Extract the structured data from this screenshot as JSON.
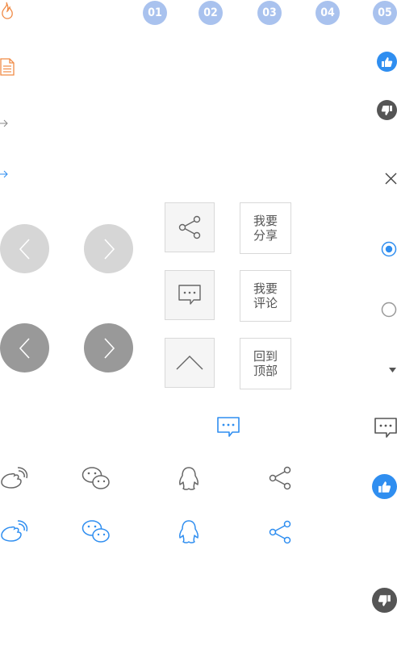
{
  "numbers": [
    "01",
    "02",
    "03",
    "04",
    "05"
  ],
  "share_panel": {
    "share_label": "我要分享",
    "comment_label": "我要评论",
    "top_label": "回到顶部"
  },
  "colors": {
    "badge": "#a9c2ee",
    "orange": "#f08a45",
    "blue": "#2f8ef0",
    "gray_icon": "#666666",
    "light_circle": "#d6d6d6",
    "dark_circle": "#999999"
  },
  "icons": {
    "row1": [
      "flame-icon",
      "document-icon",
      "arrow-right-icon",
      "arrow-right-icon"
    ],
    "social_gray": [
      "weibo-icon",
      "wechat-icon",
      "qq-icon",
      "share-icon"
    ],
    "social_blue": [
      "weibo-icon",
      "wechat-icon",
      "qq-icon",
      "share-icon"
    ],
    "right_column": [
      "thumbs-up-icon",
      "thumbs-down-icon",
      "close-icon",
      "radio-checked-icon",
      "radio-unchecked-icon",
      "caret-down-icon",
      "comment-icon",
      "thumbs-up-icon",
      "thumbs-down-icon"
    ]
  }
}
